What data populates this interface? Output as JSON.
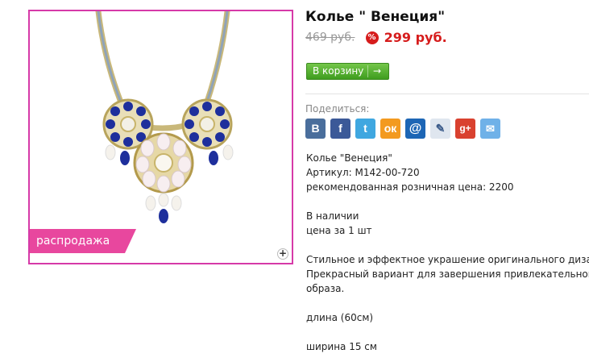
{
  "product": {
    "title": "Колье \" Венеция\"",
    "old_price": "469 руб.",
    "discount_badge": "%",
    "new_price": "299 руб.",
    "sale_label": "распродажа",
    "zoom_icon": "+"
  },
  "actions": {
    "cart_label": "В корзину",
    "cart_arrow": "→"
  },
  "share": {
    "label": "Поделиться:",
    "icons": [
      {
        "name": "vkontakte-icon",
        "glyph": "B"
      },
      {
        "name": "facebook-icon",
        "glyph": "f"
      },
      {
        "name": "twitter-icon",
        "glyph": "t"
      },
      {
        "name": "odnoklassniki-icon",
        "glyph": "ок"
      },
      {
        "name": "mailru-icon",
        "glyph": "@"
      },
      {
        "name": "livejournal-icon",
        "glyph": "✎"
      },
      {
        "name": "google-plus-icon",
        "glyph": "g+"
      },
      {
        "name": "email-icon",
        "glyph": "✉"
      }
    ]
  },
  "description": {
    "name": "Колье \"Венеция\"",
    "sku": "Артикул: M142-00-720",
    "retail_price": "рекомендованная розничная цена: 2200",
    "availability": "В наличии",
    "unit": "цена за 1 шт",
    "text_line1": "Стильное и эффектное украшение оригинального дизайна.",
    "text_line2": "Прекрасный вариант для завершения привлекательного",
    "text_line3": "образа.",
    "length": "длина  (60см)",
    "width": "ширина 15 см"
  },
  "colors": {
    "frame_border": "#d63aa8",
    "sale_ribbon": "#e8479e",
    "price_red": "#d61c1c",
    "cart_green": "#4fae2c"
  }
}
